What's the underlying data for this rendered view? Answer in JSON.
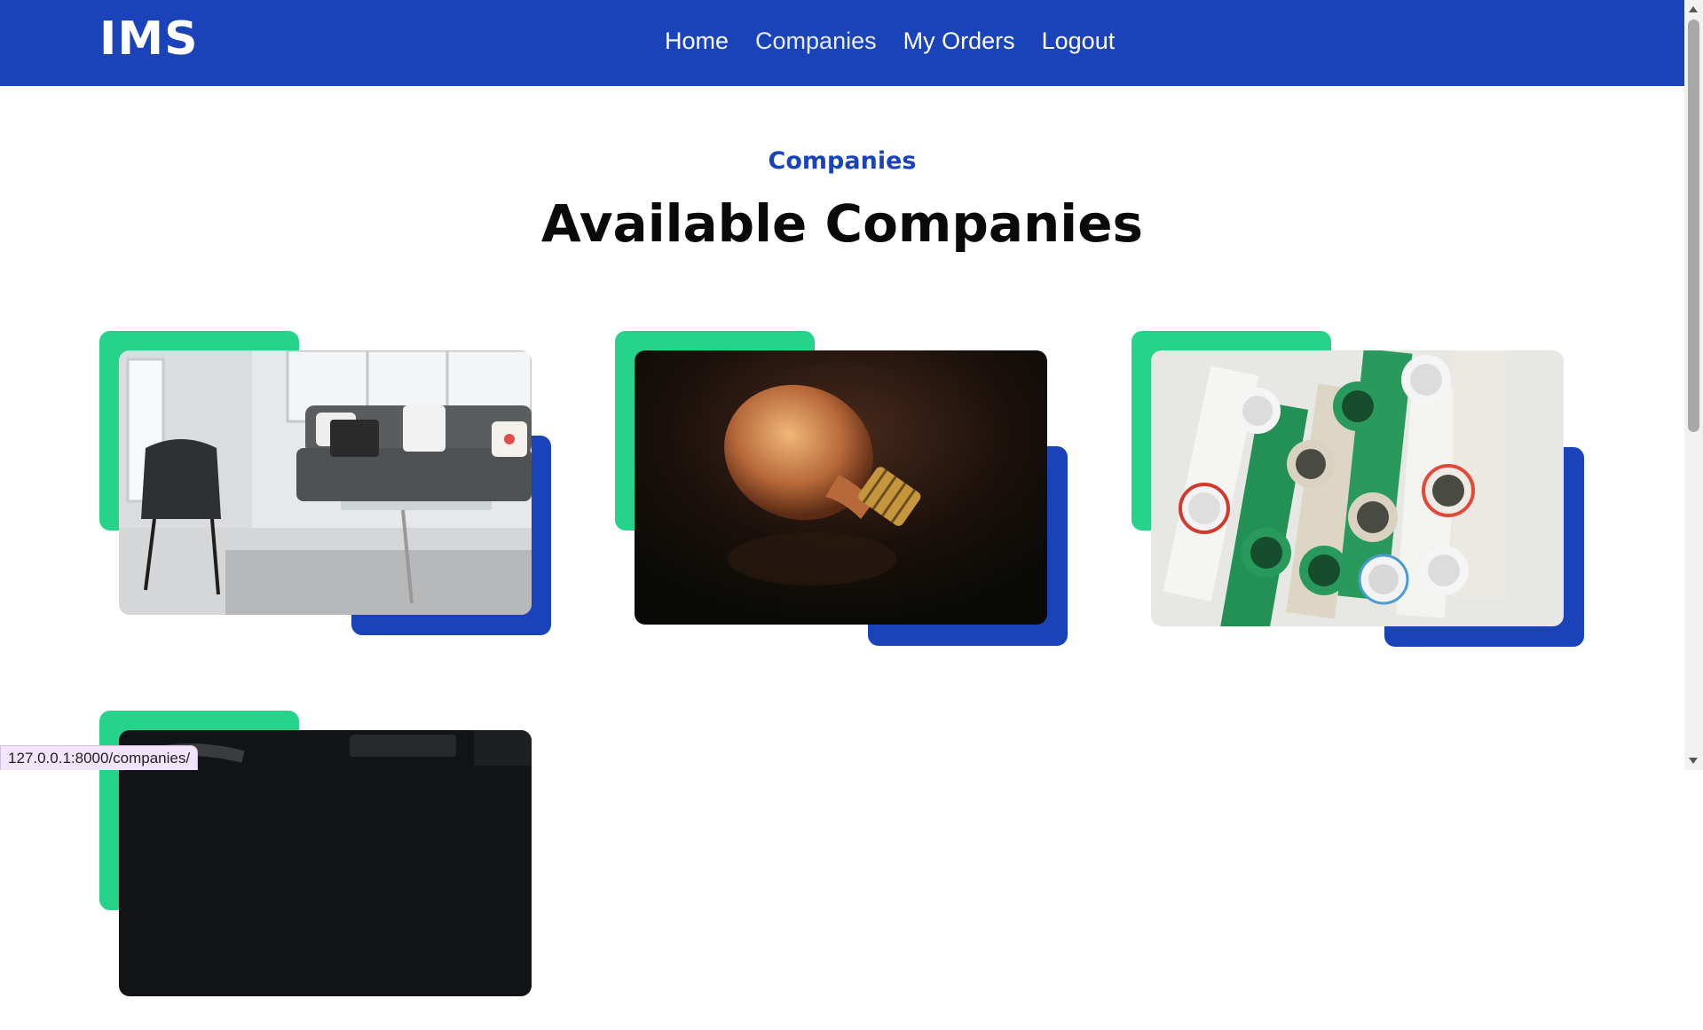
{
  "navbar": {
    "brand": "IMS",
    "links": [
      "Home",
      "Companies",
      "My Orders",
      "Logout"
    ],
    "active_link": "Companies",
    "color": "#1b43b9"
  },
  "section": {
    "tag": "Companies",
    "title": "Available Companies"
  },
  "companies": [
    {
      "image": "living-room-furniture-photo"
    },
    {
      "image": "light-bulb-photo"
    },
    {
      "image": "pipes-photo"
    },
    {
      "image": "car-interior-photo"
    }
  ],
  "accent_colors": {
    "green": "#27d38a",
    "blue": "#1b43b9"
  },
  "status_bar": {
    "url": "127.0.0.1:8000/companies/"
  }
}
